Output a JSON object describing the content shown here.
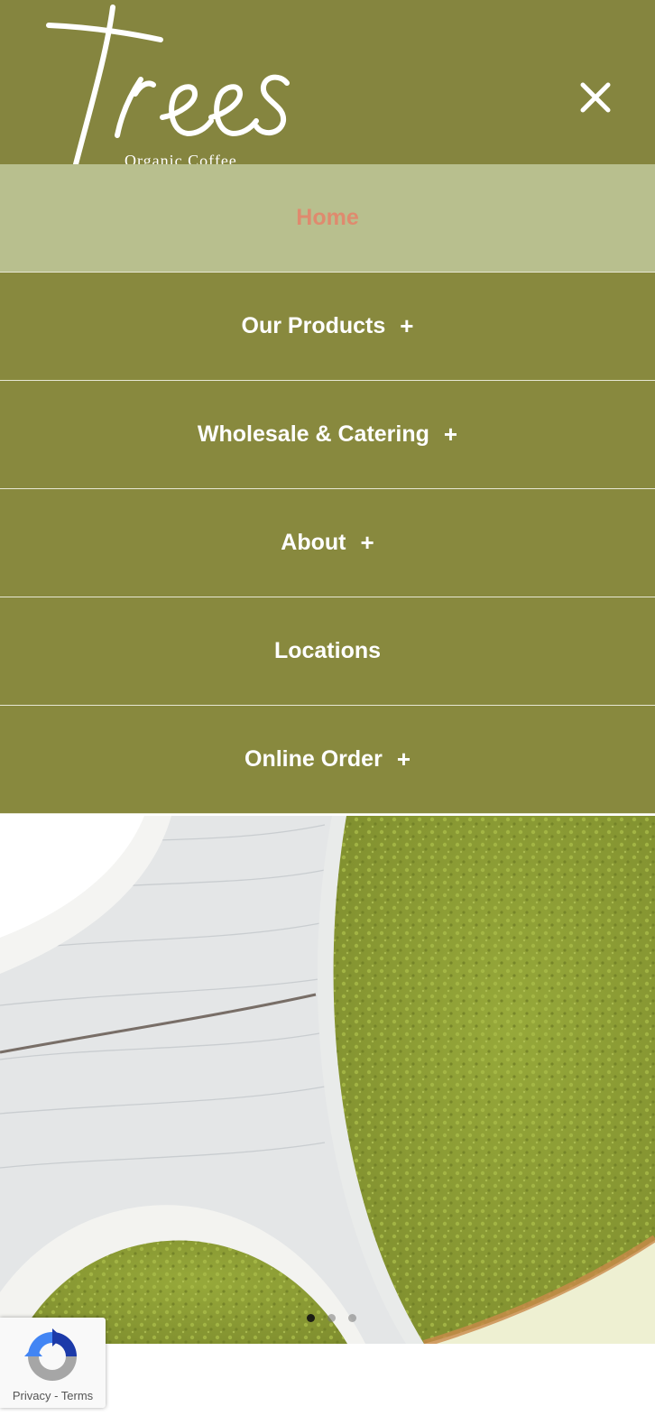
{
  "header": {
    "logo_text": "Trees",
    "logo_tagline": "Organic Coffee",
    "close_icon": "close-icon",
    "background_color": "#85853f"
  },
  "menu": {
    "items": [
      {
        "label": "Home",
        "has_submenu": false,
        "active": true
      },
      {
        "label": "Our Products",
        "has_submenu": true,
        "active": false
      },
      {
        "label": "Wholesale & Catering",
        "has_submenu": true,
        "active": false
      },
      {
        "label": "About",
        "has_submenu": true,
        "active": false
      },
      {
        "label": "Locations",
        "has_submenu": false,
        "active": false
      },
      {
        "label": "Online Order",
        "has_submenu": true,
        "active": false
      }
    ],
    "expand_symbol": "+",
    "active_text_color": "#df8a6e",
    "active_background": "#b8bf8e"
  },
  "hero": {
    "image": "matcha-powder-photo",
    "slides_total": 3,
    "active_slide": 1
  },
  "recaptcha": {
    "privacy_label": "Privacy",
    "separator": " - ",
    "terms_label": "Terms"
  }
}
